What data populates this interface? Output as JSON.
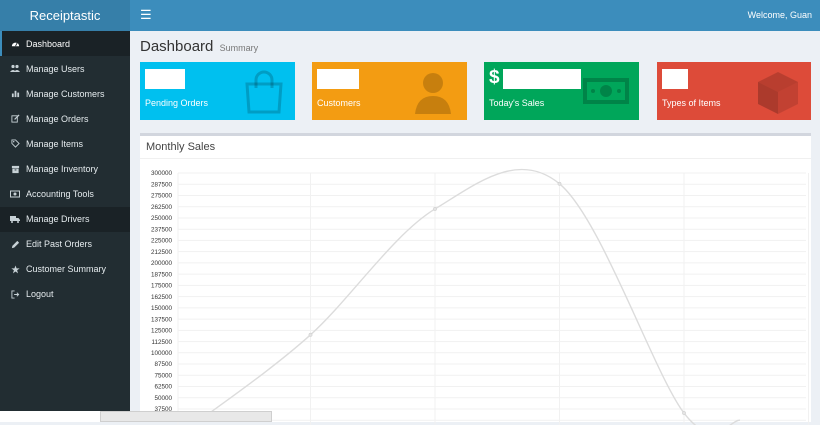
{
  "app": {
    "brand": "Receiptastic"
  },
  "topbar": {
    "welcome": "Welcome, Guan"
  },
  "sidebar": {
    "items": [
      {
        "label": "Dashboard",
        "icon": "dashboard-icon"
      },
      {
        "label": "Manage Users",
        "icon": "users-icon"
      },
      {
        "label": "Manage Customers",
        "icon": "bar-chart-icon"
      },
      {
        "label": "Manage Orders",
        "icon": "edit-icon"
      },
      {
        "label": "Manage Items",
        "icon": "tag-icon"
      },
      {
        "label": "Manage Inventory",
        "icon": "archive-icon"
      },
      {
        "label": "Accounting Tools",
        "icon": "money-icon"
      },
      {
        "label": "Manage Drivers",
        "icon": "truck-icon"
      },
      {
        "label": "Edit Past Orders",
        "icon": "pencil-icon"
      },
      {
        "label": "Customer Summary",
        "icon": "star-icon"
      },
      {
        "label": "Logout",
        "icon": "sign-out-icon"
      }
    ]
  },
  "page": {
    "title": "Dashboard",
    "subtitle": "Summary"
  },
  "tiles": [
    {
      "label": "Pending Orders",
      "color": "#00c0ef",
      "icon": "shopping-bag-icon"
    },
    {
      "label": "Customers",
      "color": "#f39c12",
      "icon": "user-icon"
    },
    {
      "label": "Today's Sales",
      "color": "#00a65a",
      "icon": "money-icon",
      "prefix": "$"
    },
    {
      "label": "Types of Items",
      "color": "#dd4b39",
      "icon": "cube-icon"
    }
  ],
  "panel": {
    "title": "Monthly Sales"
  },
  "chart_data": {
    "type": "line",
    "yticks": [
      300000,
      287500,
      275000,
      262500,
      250000,
      237500,
      225000,
      212500,
      200000,
      187500,
      175000,
      162500,
      150000,
      137500,
      125000,
      112500,
      100000,
      87500,
      75000,
      62500,
      50000,
      37500
    ],
    "ylim": [
      25000,
      300000
    ],
    "points": [
      {
        "x": 0,
        "y": 25000
      },
      {
        "x": 1,
        "y": 120000
      },
      {
        "x": 2,
        "y": 260000
      },
      {
        "x": 3,
        "y": 288000
      },
      {
        "x": 4,
        "y": 33000
      },
      {
        "x": 5,
        "y": 25000
      }
    ],
    "grid": true,
    "line_color": "#dcdcdc"
  }
}
